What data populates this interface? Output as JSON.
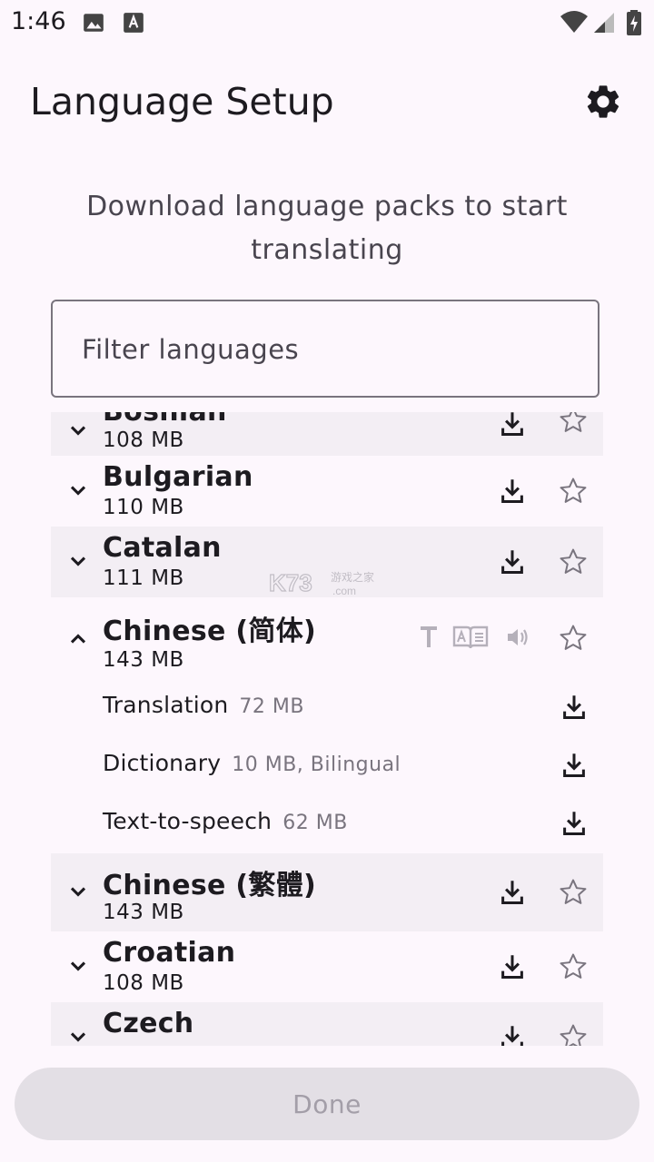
{
  "status_bar": {
    "time": "1:46",
    "icons": [
      "image-icon",
      "font-icon",
      "wifi-icon",
      "signal-icon",
      "battery-charging-icon"
    ]
  },
  "header": {
    "title": "Language Setup",
    "settings_icon": "gear-icon"
  },
  "subtitle": "Download language packs to start translating",
  "filter": {
    "placeholder": "Filter languages",
    "value": ""
  },
  "languages": [
    {
      "name": "Bosnian",
      "size": "108 MB",
      "expanded": false
    },
    {
      "name": "Bulgarian",
      "size": "110 MB",
      "expanded": false
    },
    {
      "name": "Catalan",
      "size": "111 MB",
      "expanded": false
    },
    {
      "name": "Chinese (简体)",
      "size": "143 MB",
      "expanded": true,
      "features": [
        "text-icon",
        "dictionary-icon",
        "speaker-icon"
      ],
      "packs": [
        {
          "label": "Translation",
          "meta": "72 MB"
        },
        {
          "label": "Dictionary",
          "meta": "10 MB, Bilingual"
        },
        {
          "label": "Text-to-speech",
          "meta": "62 MB"
        }
      ]
    },
    {
      "name": "Chinese (繁體)",
      "size": "143 MB",
      "expanded": false
    },
    {
      "name": "Croatian",
      "size": "108 MB",
      "expanded": false
    },
    {
      "name": "Czech",
      "size": "",
      "expanded": false
    }
  ],
  "watermark": "K73 游戏之家 .com",
  "done_label": "Done",
  "colors": {
    "background": "#fdf7fd",
    "row_shade": "#f3eef4",
    "text": "#1d1b20",
    "muted": "#79747e",
    "disabled_button": "#e3dfe5"
  }
}
